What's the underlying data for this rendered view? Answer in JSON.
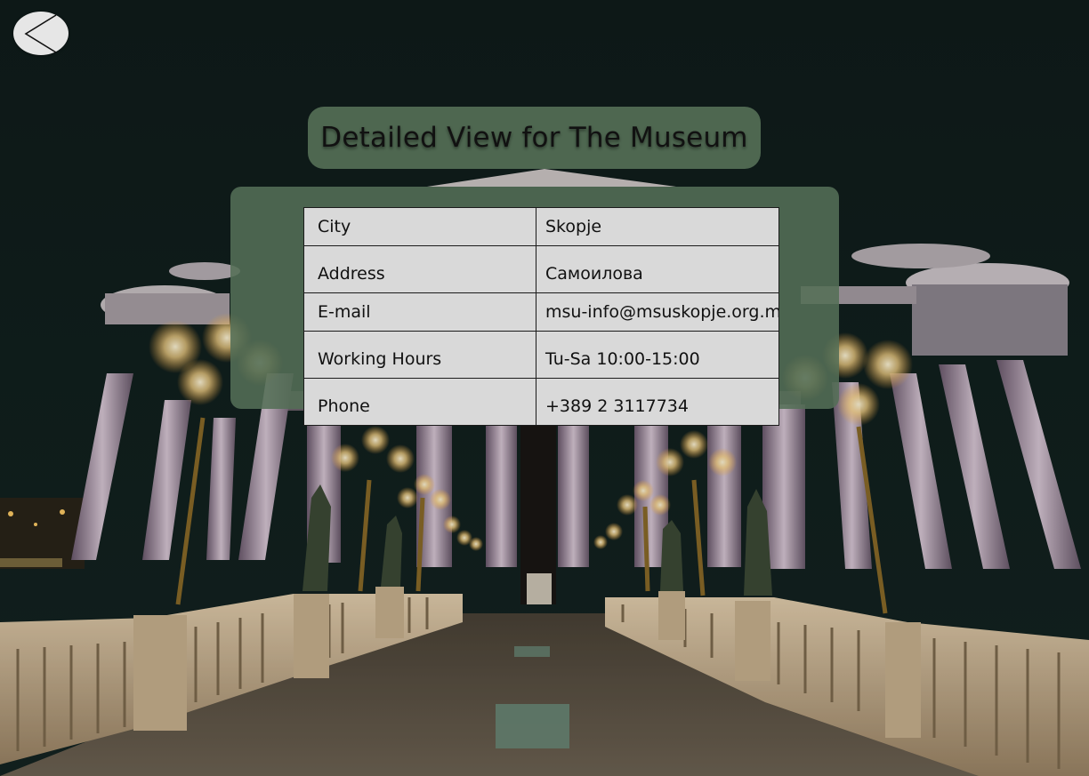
{
  "screen": {
    "back_button_icon": "chevron-left-icon",
    "title": "Detailed View for The Museum"
  },
  "details": [
    {
      "label": "City",
      "value": "Skopje"
    },
    {
      "label": "Address",
      "value": "Самоилова"
    },
    {
      "label": "E-mail",
      "value": "msu-info@msuskopje.org.mk"
    },
    {
      "label": "Working Hours",
      "value": "Tu-Sa 10:00-15:00"
    },
    {
      "label": "Phone",
      "value": "+389 2 3117734"
    }
  ],
  "colors": {
    "panel": "#546e56",
    "table_cell": "#d9d9d9",
    "back_button": "#e6e6e6",
    "sky": "#0f1a18"
  }
}
